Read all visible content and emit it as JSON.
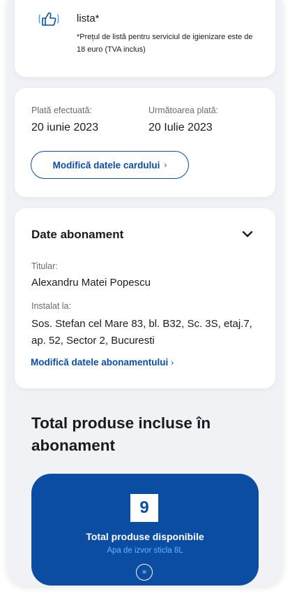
{
  "price_list": {
    "title": "lista*",
    "note": "*Prețul de listă pentru serviciul de igienizare este de 18 euro (TVA inclus)",
    "icon": "hand-thumbs-up-icon"
  },
  "payment": {
    "made_label": "Plată efectuată:",
    "made_value": "20 iunie 2023",
    "next_label": "Următoarea plată:",
    "next_value": "20 Iulie 2023",
    "modify_card_label": "Modifică datele cardului",
    "chevron": "›"
  },
  "subscription": {
    "title": "Date abonament",
    "holder_label": "Titular:",
    "holder_value": "Alexandru Matei Popescu",
    "installed_label": "Instalat la:",
    "installed_value": "Sos. Stefan cel Mare 83, bl. B32, Sc. 3S, etaj.7, ap. 52, Sector 2, Bucuresti",
    "modify_link_label": "Modifică datele abonamentului",
    "chevron": "›"
  },
  "products": {
    "heading": "Total produse incluse în abonament",
    "count": "9",
    "card_title": "Total produse disponibile",
    "card_subtitle": "Apa de izvor sticla 8L",
    "equals_symbol": "="
  },
  "colors": {
    "accent": "#0b4da2",
    "subtitle": "#5bb6ff",
    "background": "#f1f2f5"
  }
}
